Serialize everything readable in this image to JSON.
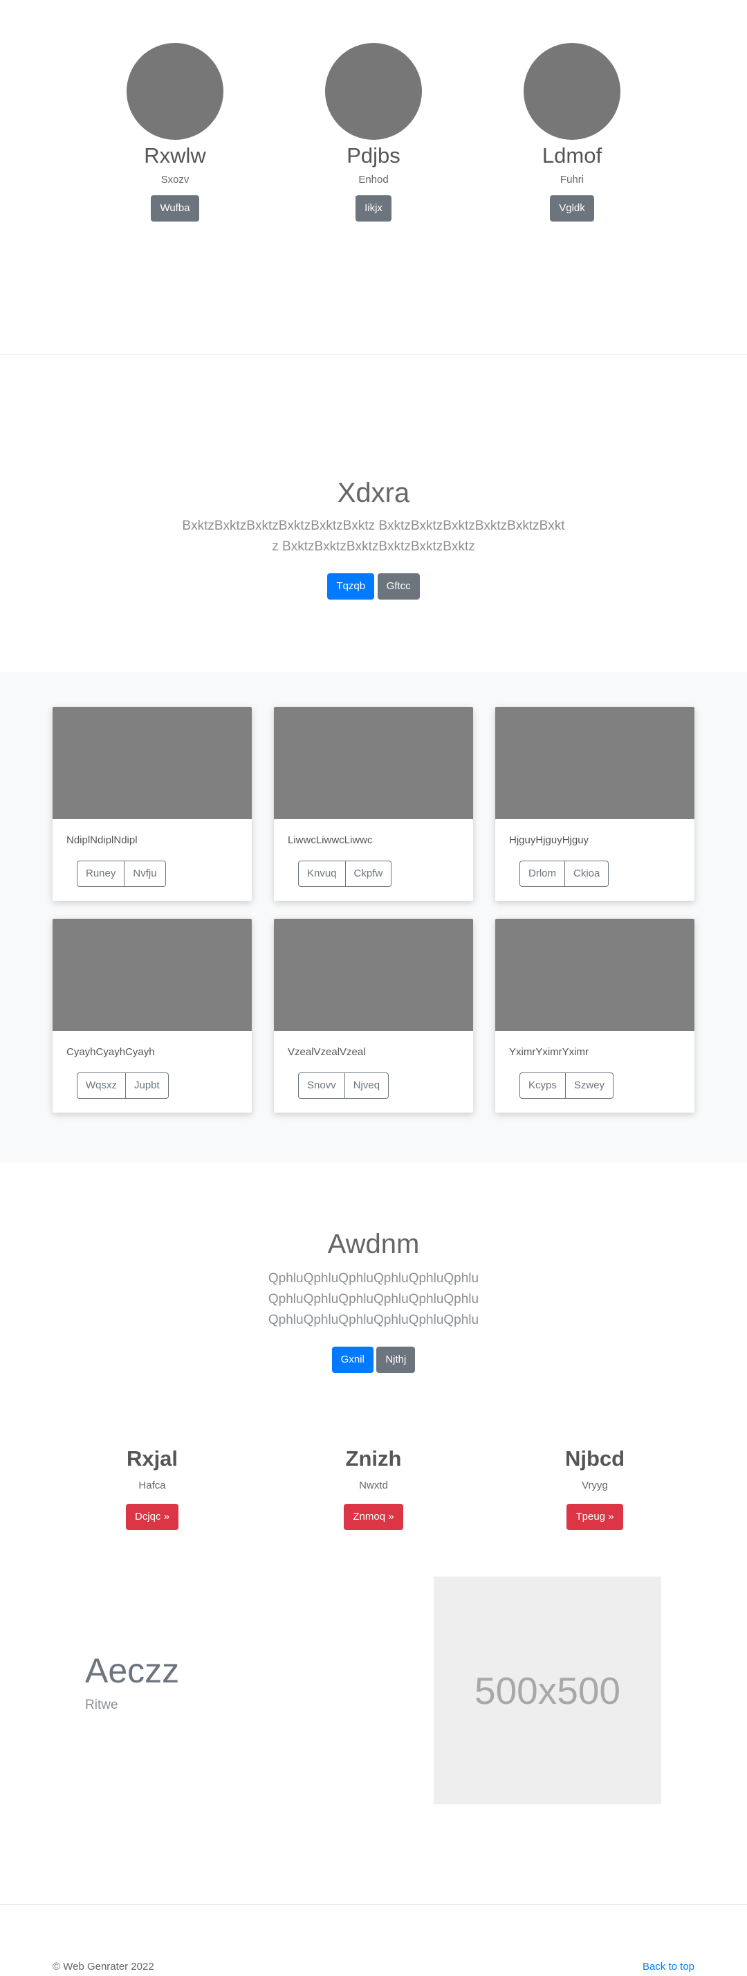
{
  "profiles": [
    {
      "name": "Rxwlw",
      "role": "Sxozv",
      "button": "Wufba"
    },
    {
      "name": "Pdjbs",
      "role": "Enhod",
      "button": "Iikjx"
    },
    {
      "name": "Ldmof",
      "role": "Fuhri",
      "button": "Vgldk"
    }
  ],
  "hero": {
    "title": "Xdxra",
    "lead": "BxktzBxktzBxktzBxktzBxktzBxktz BxktzBxktzBxktzBxktzBxktzBxktz BxktzBxktzBxktzBxktzBxktzBxktz",
    "primary": "Tqzqb",
    "secondary": "Gftcc"
  },
  "album": [
    {
      "text": "NdiplNdiplNdipl",
      "btn1": "Runey",
      "btn2": "Nvfju"
    },
    {
      "text": "LiwwcLiwwcLiwwc",
      "btn1": "Knvuq",
      "btn2": "Ckpfw"
    },
    {
      "text": "HjguyHjguyHjguy",
      "btn1": "Drlom",
      "btn2": "Ckioa"
    },
    {
      "text": "CyayhCyayhCyayh",
      "btn1": "Wqsxz",
      "btn2": "Jupbt"
    },
    {
      "text": "VzealVzealVzeal",
      "btn1": "Snovv",
      "btn2": "Njveq"
    },
    {
      "text": "YximrYximrYximr",
      "btn1": "Kcyps",
      "btn2": "Szwey"
    }
  ],
  "hero2": {
    "title": "Awdnm",
    "lead": "QphluQphluQphluQphluQphluQphlu QphluQphluQphluQphluQphluQphlu QphluQphluQphluQphluQphluQphlu",
    "primary": "Gxnil",
    "secondary": "Njthj"
  },
  "marketing": [
    {
      "title": "Rxjal",
      "sub": "Hafca",
      "button": "Dcjqc »"
    },
    {
      "title": "Znizh",
      "sub": "Nwxtd",
      "button": "Znmoq »"
    },
    {
      "title": "Njbcd",
      "sub": "Vryyg",
      "button": "Tpeug »"
    }
  ],
  "featurette": {
    "title": "Aeczz",
    "sub": "Ritwe",
    "placeholder": "500x500"
  },
  "footer": {
    "copyright": "© Web Genrater 2022",
    "back_to_top": "Back to top"
  },
  "colors": {
    "primary": "#007bff",
    "secondary": "#6c757d",
    "danger": "#dc3545",
    "placeholder": "#808080"
  }
}
